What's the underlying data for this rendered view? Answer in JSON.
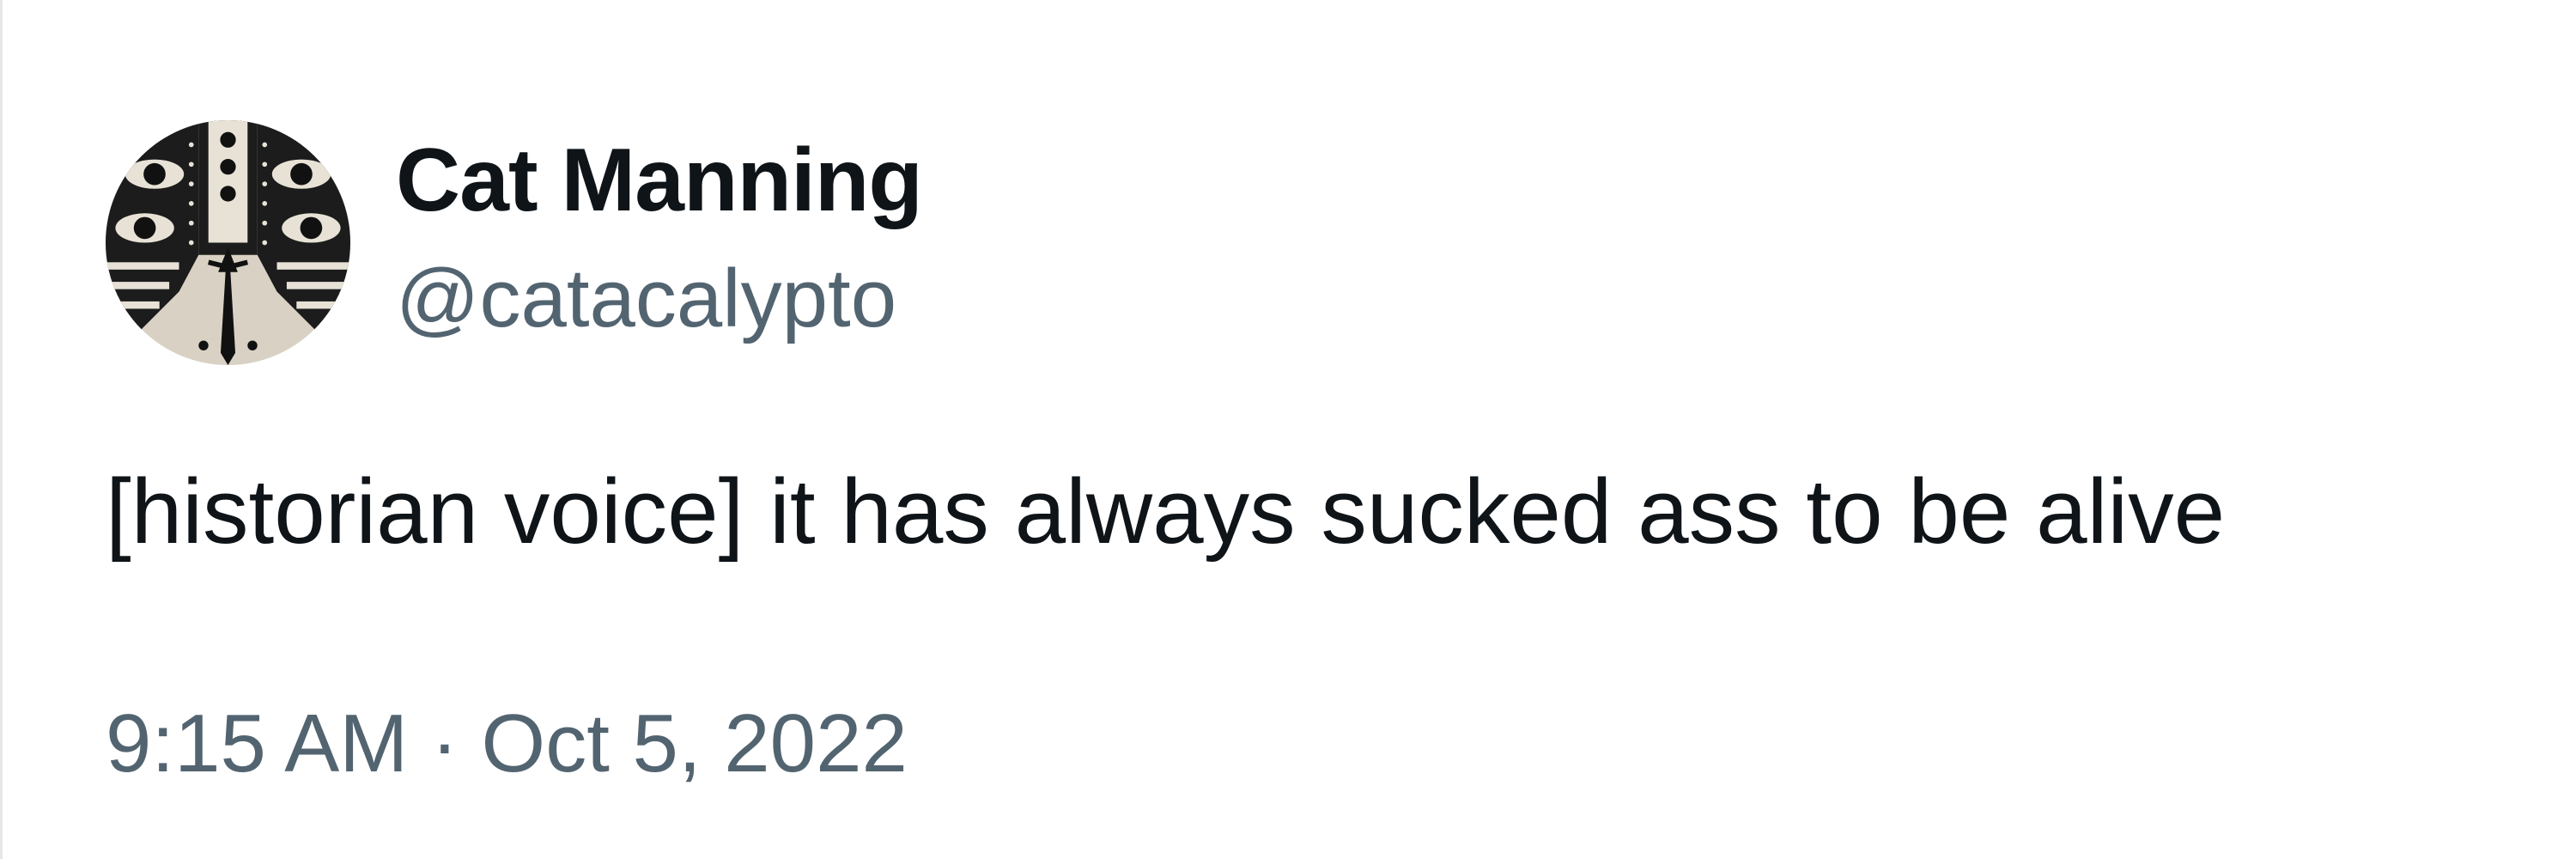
{
  "tweet": {
    "author": {
      "display_name": "Cat Manning",
      "handle": "@catacalypto",
      "avatar_icon": "tribal-mask-avatar"
    },
    "text": "[historian voice] it has always sucked ass to be alive",
    "timestamp": "9:15 AM · Oct 5, 2022"
  },
  "colors": {
    "primary_text": "#0f1419",
    "secondary_text": "#536471",
    "background": "#ffffff"
  }
}
